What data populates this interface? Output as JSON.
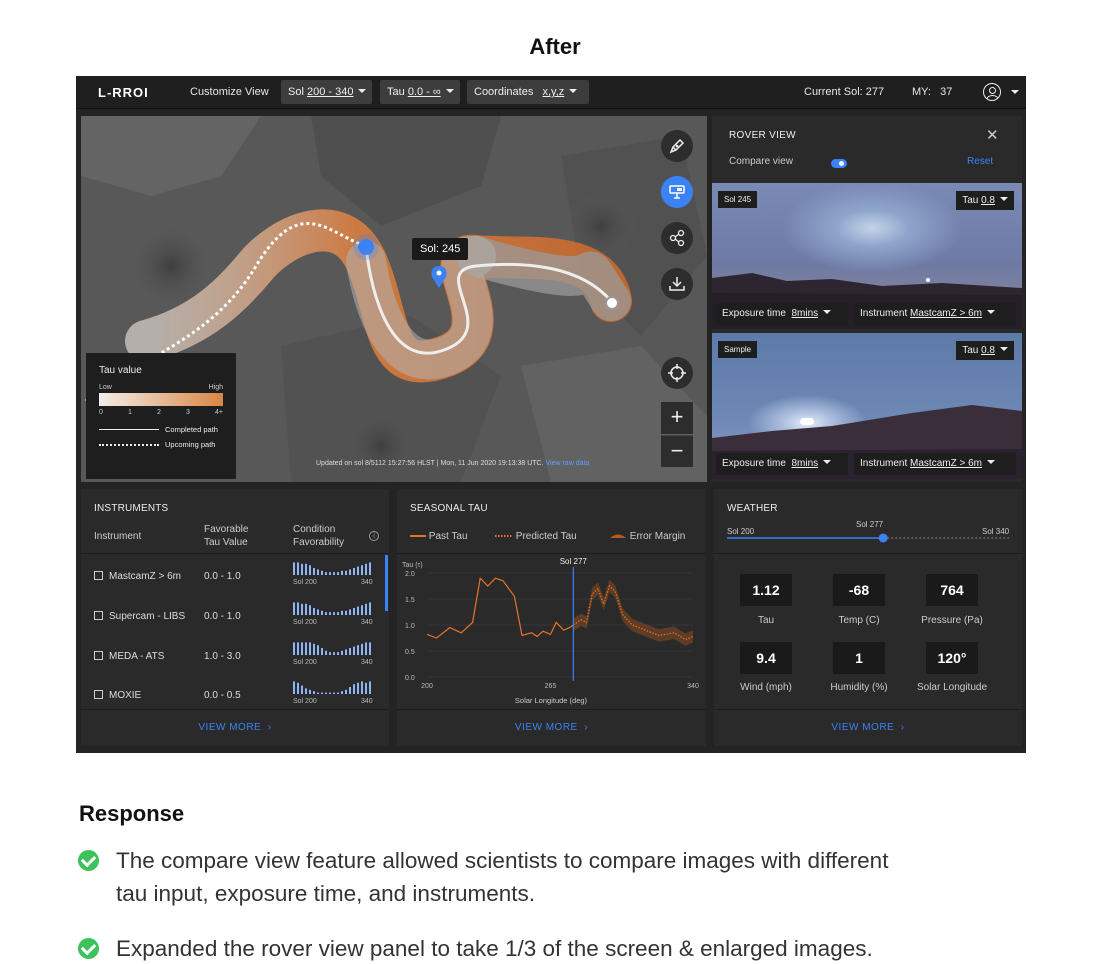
{
  "heading": "After",
  "topbar": {
    "logo": "L-RROI",
    "customize": "Customize View",
    "sol_label": "Sol",
    "sol_value": "200 - 340",
    "tau_label": "Tau",
    "tau_value": "0.0 - ∞",
    "coords_label": "Coordinates",
    "coords_value": "x,y,z",
    "current_sol_label": "Current Sol:",
    "current_sol_value": "277",
    "my_label": "MY:",
    "my_value": "37"
  },
  "map": {
    "tooltip": "Sol: 245",
    "tools": [
      "pen-icon",
      "rover-camera-icon",
      "share-icon",
      "download-icon",
      "crosshair-icon"
    ],
    "zoom_in": "+",
    "zoom_out": "−",
    "legend": {
      "title": "Tau value",
      "low": "Low",
      "high": "High",
      "ticks": [
        "0",
        "1",
        "2",
        "3",
        "4+"
      ],
      "completed": "Completed path",
      "upcoming": "Upcoming path"
    },
    "footer": "Updated on sol 8/5112 15:27:56 HLST | Mon, 11 Jun 2020 19:13:38 UTC.",
    "footer_link": "View raw data"
  },
  "rover": {
    "title": "ROVER VIEW",
    "compare": "Compare view",
    "reset": "Reset",
    "images": [
      {
        "tag": "Sol 245",
        "tau_label": "Tau",
        "tau_value": "0.8",
        "exposure_label": "Exposure time",
        "exposure_value": "8mins",
        "instrument_label": "Instrument",
        "instrument_value": "MastcamZ  > 6m"
      },
      {
        "tag": "Sample",
        "tau_label": "Tau",
        "tau_value": "0.8",
        "exposure_label": "Exposure time",
        "exposure_value": "8mins",
        "instrument_label": "Instrument",
        "instrument_value": "MastcamZ  > 6m"
      }
    ]
  },
  "instruments": {
    "title": "INSTRUMENTS",
    "col_instrument": "Instrument",
    "col_tau_1": "Favorable",
    "col_tau_2": "Tau Value",
    "col_cond_1": "Condition",
    "col_cond_2": "Favorability",
    "rows": [
      {
        "name": "MastcamZ > 6m",
        "range": "0.0 - 1.0",
        "from": "Sol 200",
        "to": "340"
      },
      {
        "name": "Supercam - LIBS",
        "range": "0.0 - 1.0",
        "from": "Sol 200",
        "to": "340"
      },
      {
        "name": "MEDA - ATS",
        "range": "1.0 - 3.0",
        "from": "Sol 200",
        "to": "340"
      },
      {
        "name": "MOXIE",
        "range": "0.0 - 0.5",
        "from": "Sol 200",
        "to": "340"
      }
    ],
    "view_more": "VIEW MORE"
  },
  "seasonal_tau": {
    "title": "SEASONAL TAU",
    "legend": [
      "Past Tau",
      "Predicted Tau",
      "Error Margin"
    ],
    "view_more": "VIEW MORE"
  },
  "chart_data": {
    "type": "line",
    "title": "",
    "xlabel": "Solar Longitude (deg)",
    "ylabel": "Tau (τ)",
    "xlim": [
      200,
      340
    ],
    "ylim": [
      0,
      2.0
    ],
    "x_ticks": [
      "200",
      "265",
      "340"
    ],
    "y_ticks": [
      "0.0",
      "0.5",
      "1.0",
      "1.5",
      "2.0"
    ],
    "marker_label": "Sol 277",
    "marker_x": 277,
    "series": [
      {
        "name": "Past Tau",
        "x": [
          200,
          205,
          212,
          218,
          224,
          228,
          232,
          236,
          240,
          246,
          250,
          255,
          258,
          261,
          265,
          268,
          272,
          275,
          277
        ],
        "y": [
          0.82,
          0.75,
          0.95,
          0.85,
          1.05,
          1.9,
          1.75,
          1.9,
          1.85,
          1.55,
          0.8,
          0.85,
          0.78,
          0.88,
          0.82,
          1.05,
          0.9,
          0.95,
          1.0
        ]
      },
      {
        "name": "Predicted Tau",
        "x": [
          277,
          281,
          284,
          287,
          290,
          293,
          296,
          299,
          303,
          308,
          315,
          322,
          330,
          336,
          340
        ],
        "y": [
          1.0,
          1.1,
          1.05,
          1.6,
          1.7,
          1.4,
          1.75,
          1.65,
          1.2,
          1.0,
          0.9,
          0.8,
          0.85,
          0.72,
          0.78
        ]
      }
    ],
    "grid": true
  },
  "weather": {
    "title": "WEATHER",
    "slider_from": "Sol 200",
    "slider_current": "Sol 277",
    "slider_to": "Sol 340",
    "slider_fraction": 0.55,
    "stats": [
      {
        "value": "1.12",
        "label": "Tau"
      },
      {
        "value": "-68",
        "label": "Temp (C)"
      },
      {
        "value": "764",
        "label": "Pressure (Pa)"
      },
      {
        "value": "9.4",
        "label": "Wind (mph)"
      },
      {
        "value": "1",
        "label": "Humidity (%)"
      },
      {
        "value": "120°",
        "label": "Solar Longitude"
      }
    ],
    "view_more": "VIEW MORE"
  },
  "response": {
    "title": "Response",
    "items": [
      {
        "line1": "The compare view feature allowed scientists to compare images with different",
        "line2": "tau input, exposure time, and instruments."
      },
      {
        "line1": "Expanded the rover view panel to take 1/3 of the screen & enlarged images.",
        "line2": ""
      }
    ]
  }
}
